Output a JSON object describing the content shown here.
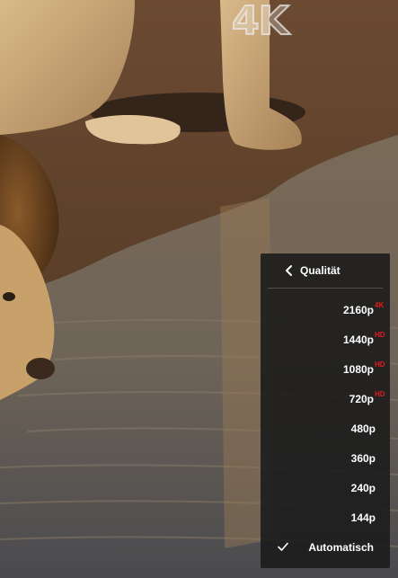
{
  "video": {
    "watermark_text": "4K"
  },
  "quality_menu": {
    "title": "Qualität",
    "back_icon": "chevron-left-icon",
    "items": [
      {
        "label": "2160p",
        "badge": "4K"
      },
      {
        "label": "1440p",
        "badge": "HD"
      },
      {
        "label": "1080p",
        "badge": "HD"
      },
      {
        "label": "720p",
        "badge": "HD"
      },
      {
        "label": "480p",
        "badge": ""
      },
      {
        "label": "360p",
        "badge": ""
      },
      {
        "label": "240p",
        "badge": ""
      },
      {
        "label": "144p",
        "badge": ""
      }
    ],
    "selected": {
      "label": "Automatisch",
      "icon": "checkmark-icon"
    },
    "badge_color": "#e21d1d"
  }
}
